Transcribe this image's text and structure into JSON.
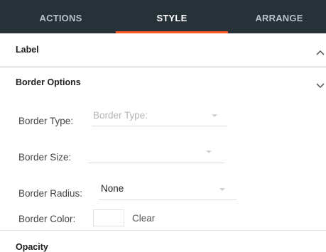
{
  "tabs": {
    "actions": "ACTIONS",
    "style": "STYLE",
    "arrange": "ARRANGE",
    "active": "STYLE",
    "accent_color": "#ff5722",
    "bar_color": "#263238"
  },
  "sections": {
    "label": {
      "title": "Label",
      "icon": "chevron-up-icon"
    },
    "border_options": {
      "title": "Border Options",
      "icon": "chevron-down-icon",
      "fields": {
        "border_type": {
          "label": "Border Type:",
          "placeholder": "Border Type:",
          "value": ""
        },
        "border_size": {
          "label": "Border Size:",
          "value": ""
        },
        "border_radius": {
          "label": "Border Radius:",
          "value": "None"
        },
        "border_color": {
          "label": "Border Color:",
          "swatch_color": "#ffffff",
          "clear_label": "Clear"
        }
      }
    },
    "opacity": {
      "title": "Opacity",
      "icon": "chevron-down-icon"
    }
  }
}
